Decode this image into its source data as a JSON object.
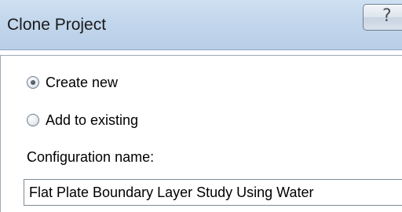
{
  "window": {
    "title": "Clone Project",
    "help_glyph": "?"
  },
  "options": {
    "create_new": {
      "label": "Create new",
      "checked": true
    },
    "add_to_existing": {
      "label": "Add to existing",
      "checked": false
    }
  },
  "configuration": {
    "label": "Configuration name:",
    "value": "Flat Plate Boundary Layer Study Using Water"
  },
  "icons": {
    "help": "help-icon"
  },
  "colors": {
    "titlebar": "#c2d6ec",
    "background": "#ffffff"
  }
}
